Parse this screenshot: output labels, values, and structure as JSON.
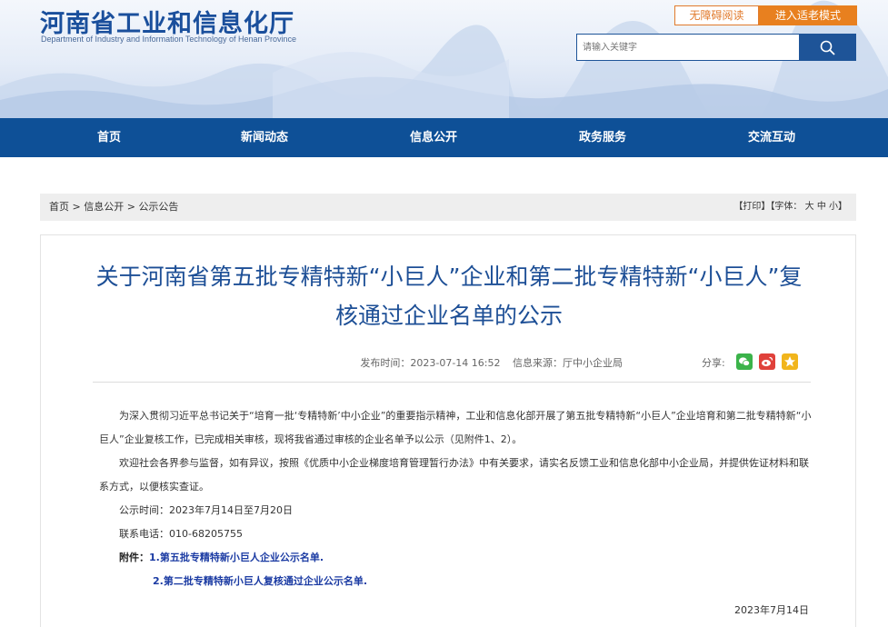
{
  "header": {
    "site_title": "河南省工业和信息化厅",
    "site_subtitle": "Department of Industry and Information Technology of Henan Province",
    "accessible_btn": "无障碍阅读",
    "elder_btn": "进入适老模式",
    "search_placeholder": "请输入关键字",
    "search_icon": "search-icon"
  },
  "nav": {
    "items": [
      "首页",
      "新闻动态",
      "信息公开",
      "政务服务",
      "交流互动"
    ]
  },
  "breadcrumb": {
    "items": [
      "首页",
      "信息公开",
      "公示公告"
    ],
    "separator": ">",
    "print": "【打印】",
    "font_label": "【字体：",
    "font_big": "大",
    "font_mid": "中",
    "font_small": "小",
    "font_end": "】"
  },
  "article": {
    "title": "关于河南省第五批专精特新“小巨人”企业和第二批专精特新“小巨人”复核通过企业名单的公示",
    "publish_time": "发布时间：2023-07-14 16:52",
    "source": "信息来源：厅中小企业局",
    "share_label": "分享:",
    "share_icons": [
      "wechat-icon",
      "weibo-icon",
      "qzone-icon"
    ],
    "share_colors": [
      "#3bb34a",
      "#e0413b",
      "#f1b51c"
    ],
    "paragraph1": "为深入贯彻习近平总书记关于“培育一批‘专精特新’中小企业”的重要指示精神，工业和信息化部开展了第五批专精特新“小巨人”企业培育和第二批专精特新“小巨人”企业复核工作，已完成相关审核，现将我省通过审核的企业名单予以公示（见附件1、2）。",
    "paragraph2": "欢迎社会各界参与监督，如有异议，按照《优质中小企业梯度培育管理暂行办法》中有关要求，请实名反馈工业和信息化部中小企业局，并提供佐证材料和联系方式，以便核实查证。",
    "period": "公示时间：2023年7月14日至7月20日",
    "phone": "联系电话：010-68205755",
    "attach_label": "附件：",
    "attachment1": "1.第五批专精特新小巨人企业公示名单.",
    "attachment2": "2.第二批专精特新小巨人复核通过企业公示名单.",
    "date": "2023年7月14日"
  },
  "colors": {
    "brand_blue": "#0e5097",
    "title_blue": "#1d4f96",
    "accent_orange": "#e8801f"
  }
}
